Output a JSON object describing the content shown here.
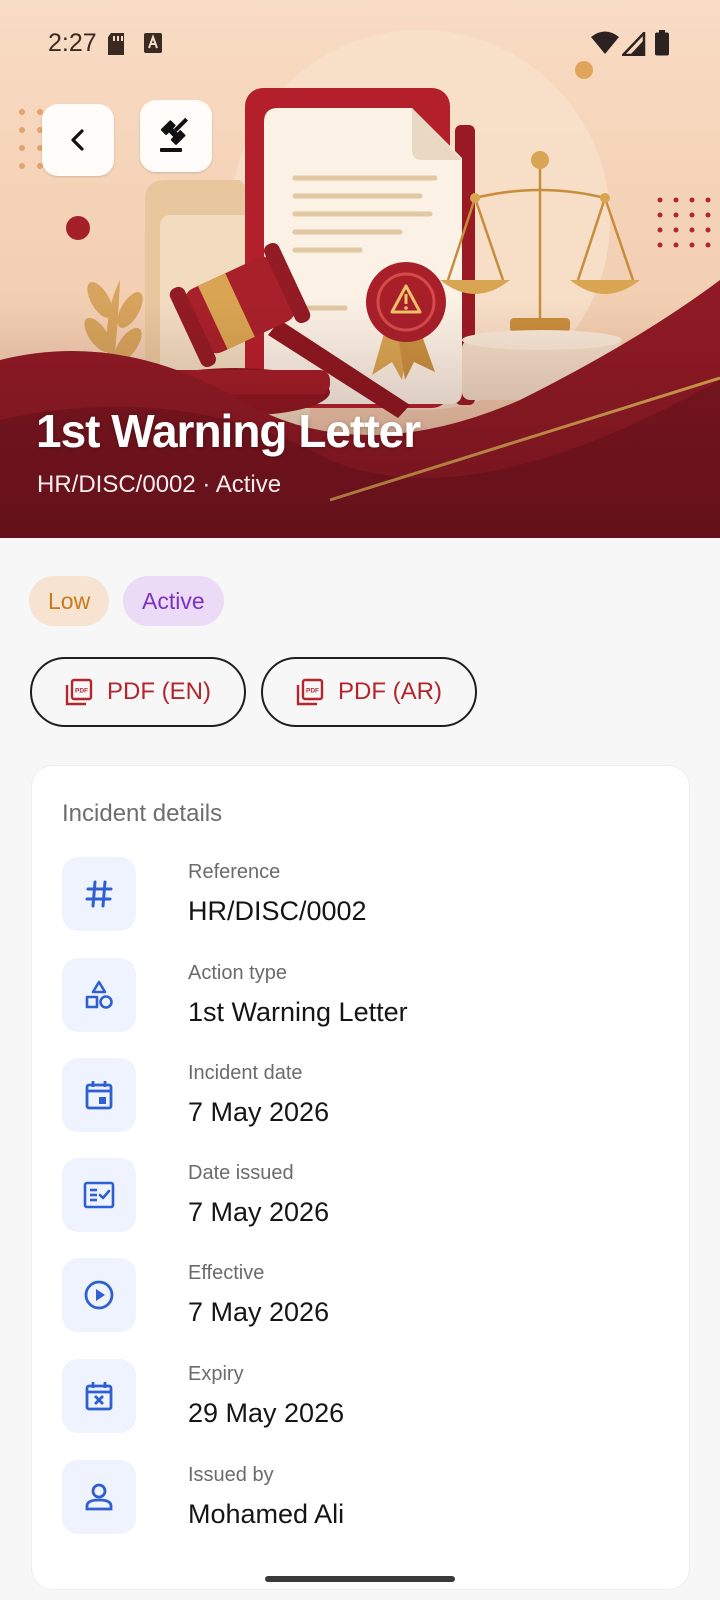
{
  "status_bar": {
    "time": "2:27"
  },
  "header": {
    "title": "1st Warning Letter",
    "subtitle": "HR/DISC/0002 · Active"
  },
  "chips": [
    {
      "label": "Low"
    },
    {
      "label": "Active"
    }
  ],
  "pdf_buttons": [
    {
      "label": "PDF (EN)"
    },
    {
      "label": "PDF (AR)"
    }
  ],
  "details": {
    "title": "Incident details",
    "rows": [
      {
        "icon": "hash-icon",
        "label": "Reference",
        "value": "HR/DISC/0002"
      },
      {
        "icon": "shapes-icon",
        "label": "Action type",
        "value": "1st Warning Letter"
      },
      {
        "icon": "calendar-event-icon",
        "label": "Incident date",
        "value": "7 May 2026"
      },
      {
        "icon": "fact-check-icon",
        "label": "Date issued",
        "value": "7 May 2026"
      },
      {
        "icon": "play-circle-icon",
        "label": "Effective",
        "value": "7 May 2026"
      },
      {
        "icon": "event-busy-icon",
        "label": "Expiry",
        "value": "29 May 2026"
      },
      {
        "icon": "person-icon",
        "label": "Issued by",
        "value": "Mohamed Ali"
      }
    ]
  },
  "colors": {
    "accent_red": "#b3262e",
    "icon_blue": "#2f5fd0",
    "low_chip_text": "#c97a1a",
    "active_chip_text": "#7d32c5"
  }
}
